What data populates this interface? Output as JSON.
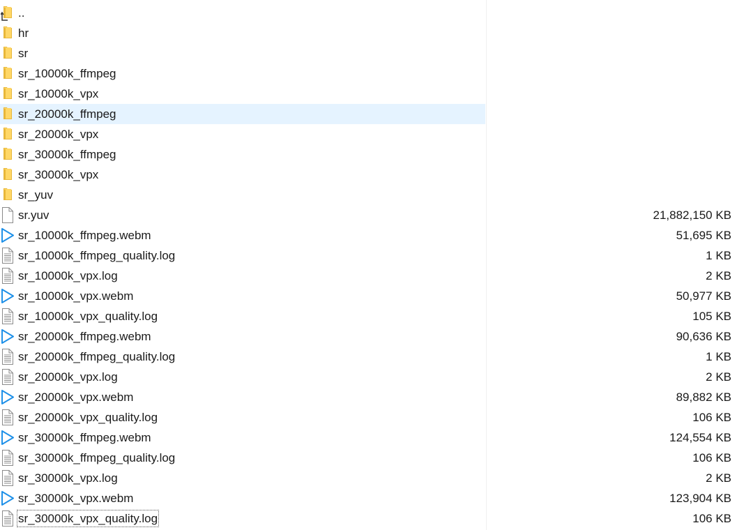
{
  "colors": {
    "folder": "#ffd766",
    "folder_dark": "#e8b739",
    "play": "#1e90e8",
    "doc_stroke": "#8a8a8a",
    "selection": "#e5f3ff"
  },
  "files": [
    {
      "name": "..",
      "size": "",
      "icon": "folder-up-icon"
    },
    {
      "name": "hr",
      "size": "",
      "icon": "folder-icon"
    },
    {
      "name": "sr",
      "size": "",
      "icon": "folder-icon"
    },
    {
      "name": "sr_10000k_ffmpeg",
      "size": "",
      "icon": "folder-icon"
    },
    {
      "name": "sr_10000k_vpx",
      "size": "",
      "icon": "folder-icon"
    },
    {
      "name": "sr_20000k_ffmpeg",
      "size": "",
      "icon": "folder-icon",
      "selected": true
    },
    {
      "name": "sr_20000k_vpx",
      "size": "",
      "icon": "folder-icon"
    },
    {
      "name": "sr_30000k_ffmpeg",
      "size": "",
      "icon": "folder-icon"
    },
    {
      "name": "sr_30000k_vpx",
      "size": "",
      "icon": "folder-icon"
    },
    {
      "name": "sr_yuv",
      "size": "",
      "icon": "folder-icon"
    },
    {
      "name": "sr.yuv",
      "size": "21,882,150 KB",
      "icon": "blank-file-icon"
    },
    {
      "name": "sr_10000k_ffmpeg.webm",
      "size": "51,695 KB",
      "icon": "play-icon"
    },
    {
      "name": "sr_10000k_ffmpeg_quality.log",
      "size": "1 KB",
      "icon": "text-file-icon"
    },
    {
      "name": "sr_10000k_vpx.log",
      "size": "2 KB",
      "icon": "text-file-icon"
    },
    {
      "name": "sr_10000k_vpx.webm",
      "size": "50,977 KB",
      "icon": "play-icon"
    },
    {
      "name": "sr_10000k_vpx_quality.log",
      "size": "105 KB",
      "icon": "text-file-icon"
    },
    {
      "name": "sr_20000k_ffmpeg.webm",
      "size": "90,636 KB",
      "icon": "play-icon"
    },
    {
      "name": "sr_20000k_ffmpeg_quality.log",
      "size": "1 KB",
      "icon": "text-file-icon"
    },
    {
      "name": "sr_20000k_vpx.log",
      "size": "2 KB",
      "icon": "text-file-icon"
    },
    {
      "name": "sr_20000k_vpx.webm",
      "size": "89,882 KB",
      "icon": "play-icon"
    },
    {
      "name": "sr_20000k_vpx_quality.log",
      "size": "106 KB",
      "icon": "text-file-icon"
    },
    {
      "name": "sr_30000k_ffmpeg.webm",
      "size": "124,554 KB",
      "icon": "play-icon"
    },
    {
      "name": "sr_30000k_ffmpeg_quality.log",
      "size": "106 KB",
      "icon": "text-file-icon"
    },
    {
      "name": "sr_30000k_vpx.log",
      "size": "2 KB",
      "icon": "text-file-icon"
    },
    {
      "name": "sr_30000k_vpx.webm",
      "size": "123,904 KB",
      "icon": "play-icon"
    },
    {
      "name": "sr_30000k_vpx_quality.log",
      "size": "106 KB",
      "icon": "text-file-icon",
      "focused": true
    }
  ]
}
